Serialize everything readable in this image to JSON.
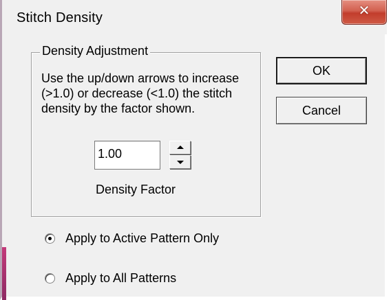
{
  "window": {
    "title": "Stitch Density",
    "close_icon": "close-icon"
  },
  "group": {
    "legend": "Density Adjustment",
    "instructions": [
      "Use the up/down arrows to increase",
      "(>1.0) or decrease (<1.0)  the stitch",
      "density by the factor shown."
    ],
    "density_value": "1.00",
    "density_label": "Density Factor",
    "spin_up_icon": "spin-up-arrow-icon",
    "spin_down_icon": "spin-down-arrow-icon"
  },
  "buttons": {
    "ok": "OK",
    "cancel": "Cancel"
  },
  "apply_options": {
    "selected": "active",
    "active_label": "Apply to Active Pattern Only",
    "all_label": "Apply to All Patterns"
  },
  "colors": {
    "dialog_bg": "#f0f0f0",
    "close_button": "#c94a38"
  }
}
